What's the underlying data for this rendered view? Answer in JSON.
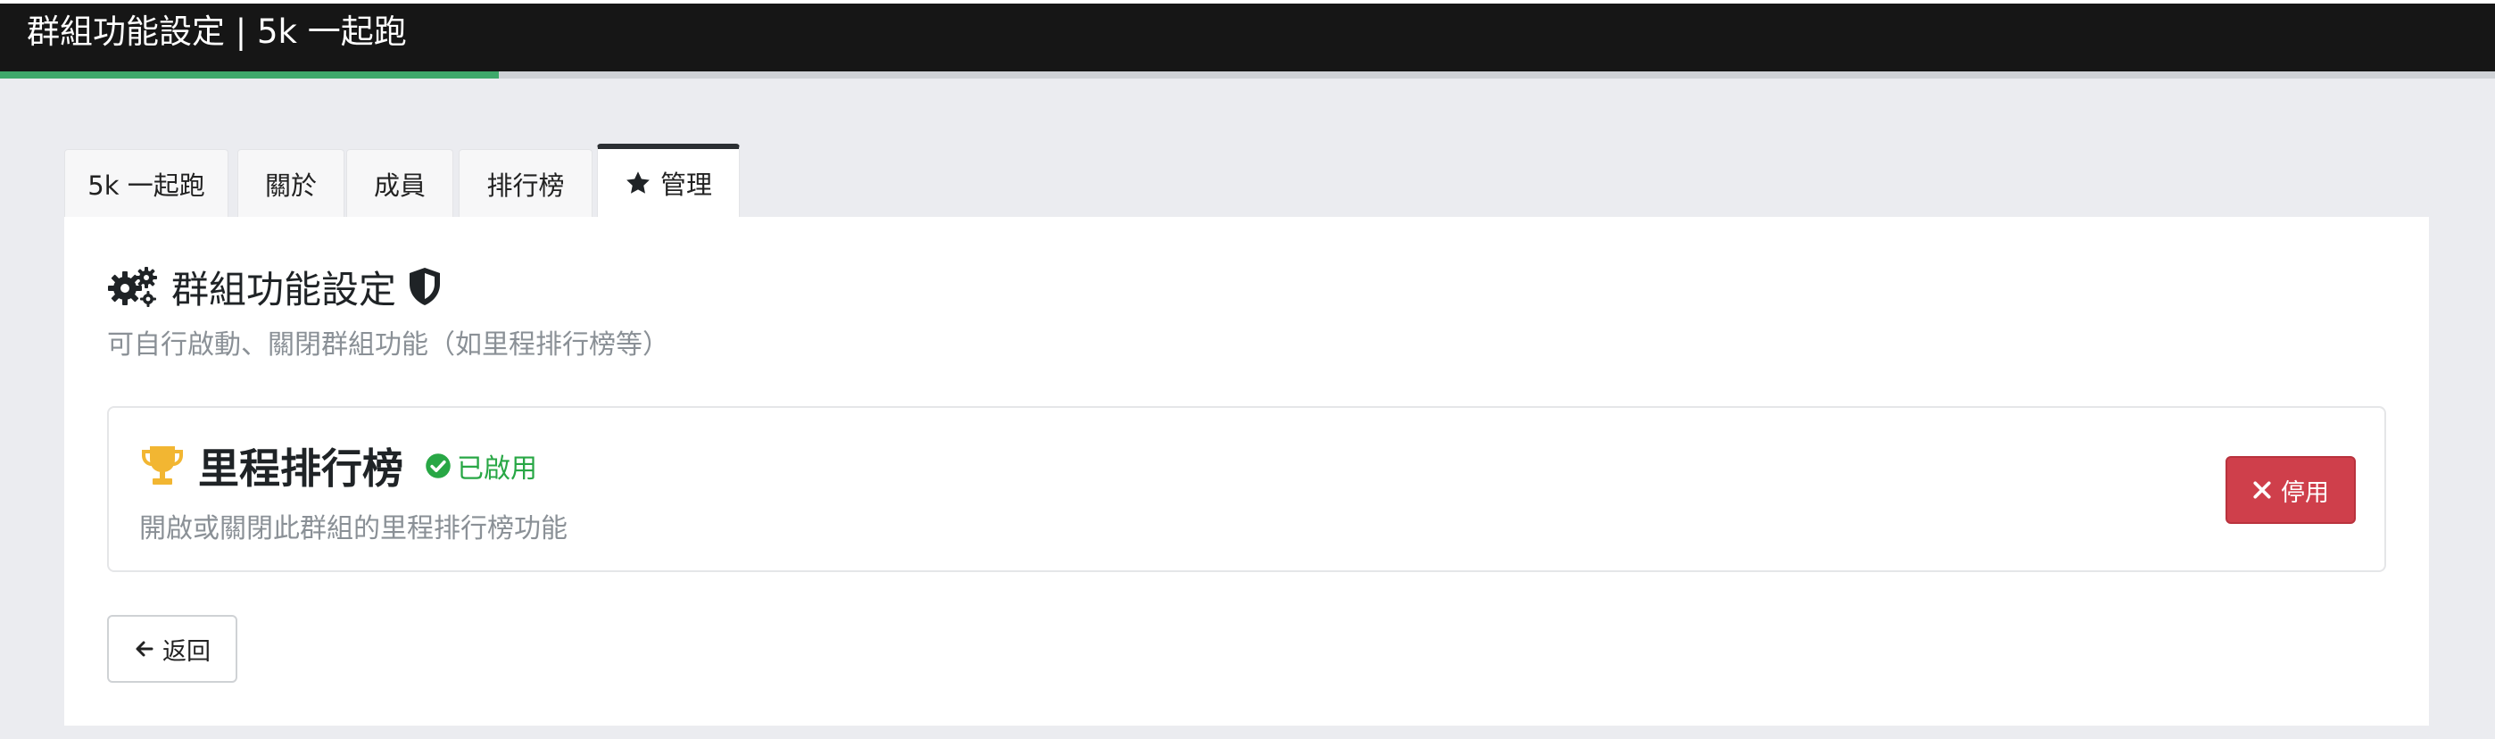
{
  "header": {
    "title": "群組功能設定 | 5k 一起跑",
    "progress_fraction": 0.2
  },
  "tabs": [
    {
      "label": "5k 一起跑",
      "active": false
    },
    {
      "label": "關於",
      "active": false
    },
    {
      "label": "成員",
      "active": false
    },
    {
      "label": "排行榜",
      "active": false
    },
    {
      "label": "管理",
      "active": true,
      "icon": "star-icon"
    }
  ],
  "panel": {
    "title": "群組功能設定",
    "title_icons": [
      "gears-icon",
      "shield-icon"
    ],
    "subtitle": "可自行啟動、關閉群組功能（如里程排行榜等）"
  },
  "feature": {
    "icon": "trophy-icon",
    "name": "里程排行榜",
    "status_icon": "check-circle-icon",
    "status": "已啟用",
    "description": "開啟或關閉此群組的里程排行榜功能",
    "action_label": "停用",
    "action_icon": "times-icon"
  },
  "back_button": {
    "label": "返回",
    "icon": "arrow-left-icon"
  },
  "colors": {
    "header_bg": "#161616",
    "progress": "#3fa86b",
    "status_green": "#28a745",
    "danger": "#cf3f4b",
    "trophy": "#f2b632"
  }
}
